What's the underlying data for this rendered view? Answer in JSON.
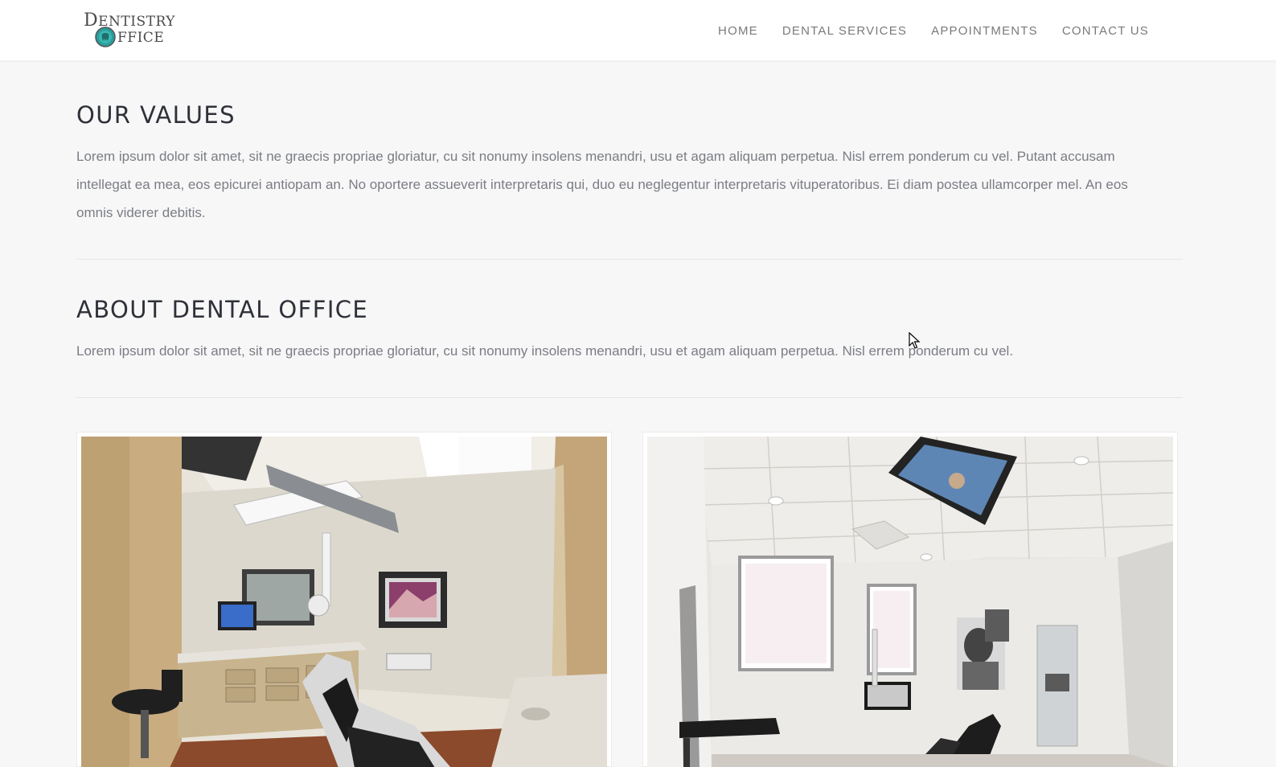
{
  "brand": {
    "line1_first": "D",
    "line1_rest": "ENTISTRY",
    "line2_rest": "FFICE"
  },
  "nav": {
    "items": [
      {
        "label": "HOME"
      },
      {
        "label": "DENTAL SERVICES"
      },
      {
        "label": "APPOINTMENTS"
      },
      {
        "label": "CONTACT US"
      }
    ]
  },
  "values": {
    "title": "OUR VALUES",
    "text": "Lorem ipsum dolor sit amet, sit ne graecis propriae gloriatur, cu sit nonumy insolens menandri, usu et agam aliquam perpetua. Nisl errem ponderum cu vel. Putant accusam intellegat ea mea, eos epicurei antiopam an. No oportere assueverit interpretaris qui, duo eu neglegentur interpretaris vituperatoribus. Ei diam postea ullamcorper mel. An eos omnis viderer debitis."
  },
  "about": {
    "title": "ABOUT DENTAL OFFICE",
    "text": "Lorem ipsum dolor sit amet, sit ne graecis propriae gloriatur, cu sit nonumy insolens menandri, usu et agam aliquam perpetua. Nisl errem ponderum cu vel."
  },
  "colors": {
    "background": "#f7f7f7",
    "heading": "#2f3139",
    "body_text": "#7b7d85",
    "nav_text": "#7a7a7a",
    "logo_accent": "#2a9d9a"
  }
}
